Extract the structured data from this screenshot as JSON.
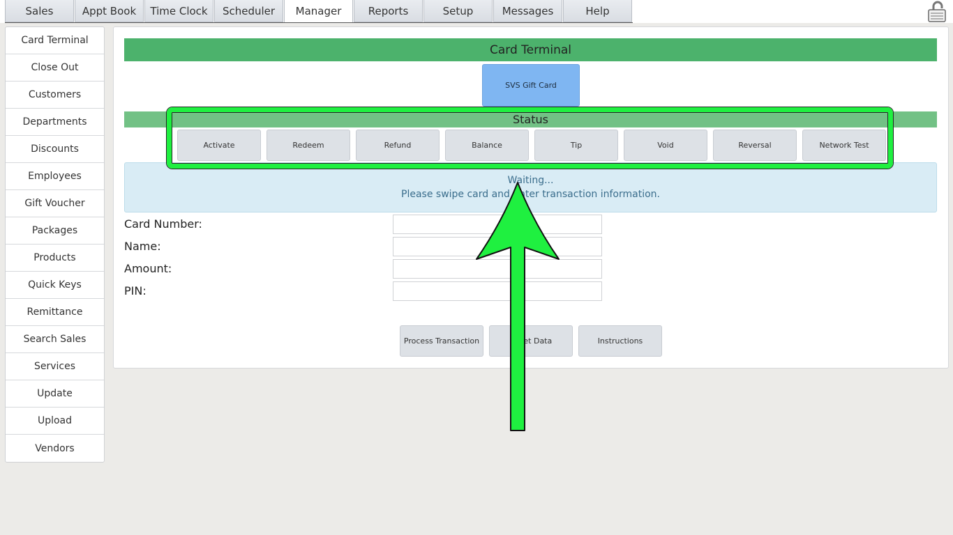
{
  "tabs": [
    "Sales",
    "Appt Book",
    "Time Clock",
    "Scheduler",
    "Manager",
    "Reports",
    "Setup",
    "Messages",
    "Help"
  ],
  "active_tab": "Manager",
  "sidebar": {
    "items": [
      "Card Terminal",
      "Close Out",
      "Customers",
      "Departments",
      "Discounts",
      "Employees",
      "Gift Voucher",
      "Packages",
      "Products",
      "Quick Keys",
      "Remittance",
      "Search Sales",
      "Services",
      "Update",
      "Upload",
      "Vendors"
    ]
  },
  "panel": {
    "title": "Card Terminal",
    "gift_card_button": "SVS Gift Card",
    "status_title": "Status",
    "actions": [
      "Activate",
      "Redeem",
      "Refund",
      "Balance",
      "Tip",
      "Void",
      "Reversal",
      "Network Test"
    ],
    "info": {
      "line1": "Waiting...",
      "line2": "Please swipe card and enter transaction information."
    },
    "form": {
      "card_number_label": "Card Number:",
      "name_label": "Name:",
      "amount_label": "Amount:",
      "pin_label": "PIN:"
    },
    "bottom_buttons": [
      "Process Transaction",
      "Reset Data",
      "Instructions"
    ]
  },
  "colors": {
    "header_green": "#4cb26c",
    "status_green": "#72c185",
    "gift_card_blue": "#7fb6f2",
    "info_bg": "#d9ecf5",
    "highlight_green": "#1ff040"
  }
}
